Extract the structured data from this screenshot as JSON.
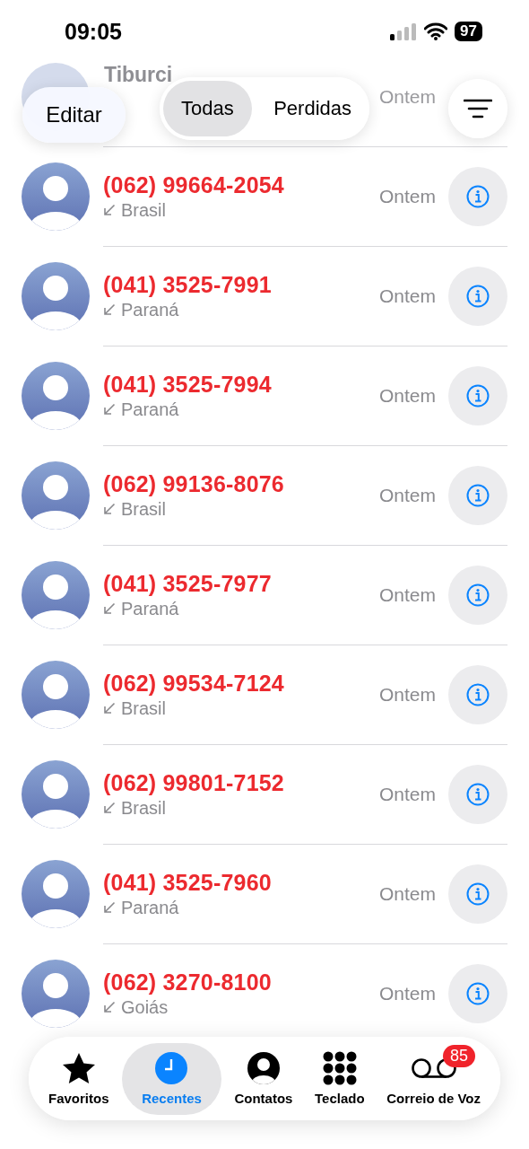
{
  "status_bar": {
    "time": "09:05",
    "battery": "97"
  },
  "header": {
    "edit_button": "Editar",
    "filters": [
      {
        "label": "Todas",
        "selected": true
      },
      {
        "label": "Perdidas",
        "selected": false
      }
    ]
  },
  "partial_row": {
    "name": "Tiburci",
    "time": "Ontem"
  },
  "calls": [
    {
      "number": "(062) 99664-2054",
      "location": "Brasil",
      "time": "Ontem",
      "missed": true
    },
    {
      "number": "(041) 3525-7991",
      "location": "Paraná",
      "time": "Ontem",
      "missed": true
    },
    {
      "number": "(041) 3525-7994",
      "location": "Paraná",
      "time": "Ontem",
      "missed": true
    },
    {
      "number": "(062) 99136-8076",
      "location": "Brasil",
      "time": "Ontem",
      "missed": true
    },
    {
      "number": "(041) 3525-7977",
      "location": "Paraná",
      "time": "Ontem",
      "missed": true
    },
    {
      "number": "(062) 99534-7124",
      "location": "Brasil",
      "time": "Ontem",
      "missed": true
    },
    {
      "number": "(062) 99801-7152",
      "location": "Brasil",
      "time": "Ontem",
      "missed": true
    },
    {
      "number": "(041) 3525-7960",
      "location": "Paraná",
      "time": "Ontem",
      "missed": true
    },
    {
      "number": "(062) 3270-8100",
      "location": "Goiás",
      "time": "Ontem",
      "missed": true
    }
  ],
  "tab_bar": [
    {
      "kind": "star",
      "label": "Favoritos",
      "selected": false
    },
    {
      "kind": "clock",
      "label": "Recentes",
      "selected": true
    },
    {
      "kind": "person",
      "label": "Contatos",
      "selected": false
    },
    {
      "kind": "keypad",
      "label": "Teclado",
      "selected": false
    },
    {
      "kind": "voicemail",
      "label": "Correio de Voz",
      "selected": false,
      "badge": "85"
    }
  ]
}
